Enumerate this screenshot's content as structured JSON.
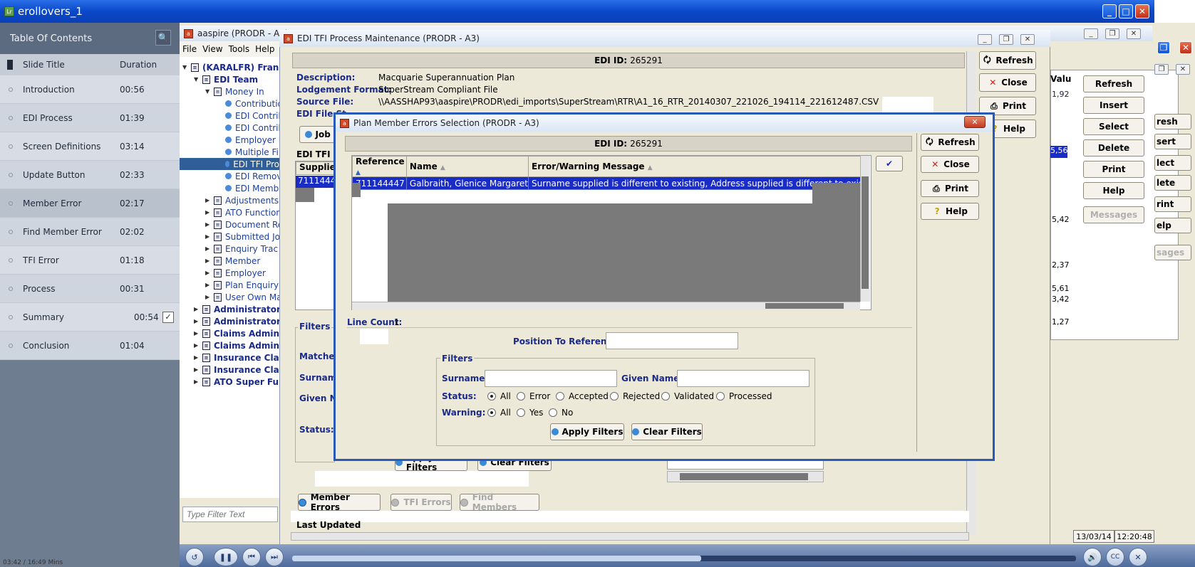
{
  "outer_window": {
    "title": "erollovers_1",
    "app_icon_text": "Lr"
  },
  "toc": {
    "title": "Table Of Contents",
    "col_slide_title": "Slide Title",
    "col_duration": "Duration",
    "items": [
      {
        "title": "Introduction",
        "duration": "00:56"
      },
      {
        "title": "EDI Process",
        "duration": "01:39"
      },
      {
        "title": "Screen Definitions",
        "duration": "03:14"
      },
      {
        "title": "Update Button",
        "duration": "02:33"
      },
      {
        "title": "Member Error",
        "duration": "02:17"
      },
      {
        "title": "Find Member Error",
        "duration": "02:02"
      },
      {
        "title": "TFI Error",
        "duration": "01:18"
      },
      {
        "title": "Process",
        "duration": "00:31"
      },
      {
        "title": "Summary",
        "duration": "00:54"
      },
      {
        "title": "Conclusion",
        "duration": "01:04"
      }
    ]
  },
  "aspire": {
    "title": "aaspire  (PRODR - A3)",
    "menu": [
      "File",
      "View",
      "Tools",
      "Help"
    ],
    "tree": [
      "(KARALFR) Frank K",
      "EDI Team",
      "Money In",
      "Contributio",
      "EDI Contrib",
      "EDI Contrib",
      "Employer M",
      "Multiple Fi",
      "EDI TFI Pro",
      "EDI Remove",
      "EDI Membe",
      "Adjustments",
      "ATO Function",
      "Document Re",
      "Submitted Jo",
      "Enquiry Trac",
      "Member",
      "Employer",
      "Plan Enquiry",
      "User Own Ma",
      "Administrator",
      "Administrator S",
      "Claims Administ",
      "Claims Administ",
      "Insurance Claim",
      "Insurance Claim",
      "ATO Super Fund"
    ],
    "filter_placeholder": "Type Filter Text"
  },
  "tfi_window": {
    "title": "EDI TFI Process Maintenance  (PRODR - A3)",
    "edi_id_label": "EDI ID:",
    "edi_id_value": "265291",
    "description_label": "Description:",
    "description_value": "Macquarie Superannuation Plan",
    "lodgement_label": "Lodgement Format:",
    "lodgement_value": "SuperStream Compliant File",
    "source_label": "Source File:",
    "source_value": "\\\\AASSHAP93\\aaspire\\PRODR\\edi_imports\\SuperStream\\RTR\\A1_16_RTR_20140307_221026_194114_221612487.CSV",
    "edi_file_label": "EDI File St",
    "job_btn": "Job I",
    "edi_tfi_members_label": "EDI TFI Me",
    "supplied_col": "Supplied",
    "supplied_row": "7111444",
    "filters_label": "Filters",
    "matched_label": "Matched",
    "surname_label": "Surname",
    "given_label": "Given Na",
    "status_label": "Status:",
    "apply_filters": "Apply Filters",
    "clear_filters": "Clear Filters",
    "tabs": {
      "member_errors": "Member Errors",
      "tfi_errors": "TFI Errors",
      "find_members": "Find Members"
    },
    "last_updated": "Last Updated",
    "buttons": {
      "refresh": "Refresh",
      "close": "Close",
      "print": "Print",
      "help": "Help"
    }
  },
  "back_panel": {
    "col_val": "Valu",
    "values": [
      "1,92",
      "5,56",
      "5,42",
      "2,37",
      "5,61",
      "3,42",
      "1,27"
    ],
    "buttons": {
      "refresh": "Refresh",
      "insert": "Insert",
      "select": "Select",
      "delete": "Delete",
      "print": "Print",
      "help": "Help",
      "messages": "Messages"
    },
    "far_buttons": [
      "resh",
      "sert",
      "lect",
      "lete",
      "rint",
      "elp",
      "sages"
    ]
  },
  "dialog": {
    "title": "Plan Member Errors Selection  (PRODR - A3)",
    "edi_id_label": "EDI ID:",
    "edi_id_value": "265291",
    "columns": [
      "Reference",
      "Name",
      "Error/Warning Message"
    ],
    "rows": [
      {
        "reference": "711144447",
        "name": "Galbraith, Glenice Margaret",
        "message": "Surname supplied is different to existing, Address supplied is different to existing,..."
      }
    ],
    "line_count_label": "Line Count:",
    "line_count_value": "1",
    "position_label": "Position To Reference:",
    "filters_label": "Filters",
    "surname_label": "Surname:",
    "given_label": "Given Name:",
    "status_label": "Status:",
    "status_options": [
      "All",
      "Error",
      "Accepted",
      "Rejected",
      "Validated",
      "Processed"
    ],
    "warning_label": "Warning:",
    "warning_options": [
      "All",
      "Yes",
      "No"
    ],
    "apply_filters": "Apply Filters",
    "clear_filters": "Clear Filters",
    "buttons": {
      "refresh": "Refresh",
      "close": "Close",
      "print": "Print",
      "help": "Help"
    }
  },
  "statusbar": {
    "date": "13/03/14",
    "time": "12:20:48"
  },
  "player": {
    "time": "03:42 / 16:49 Mins"
  }
}
